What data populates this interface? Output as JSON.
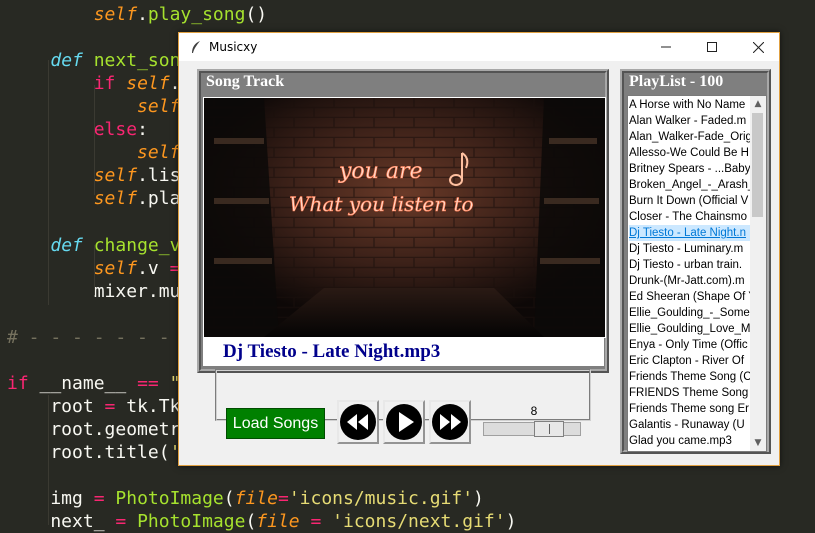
{
  "editor": {
    "lines": [
      {
        "parts": [
          [
            "",
            "        "
          ],
          [
            "self",
            "self"
          ],
          [
            "",
            "."
          ],
          [
            "fn",
            "play_song"
          ],
          [
            "",
            "()"
          ]
        ]
      },
      {
        "parts": []
      },
      {
        "parts": [
          [
            "",
            "    "
          ],
          [
            "kwd",
            "def"
          ],
          [
            "",
            " "
          ],
          [
            "fn",
            "next_son"
          ]
        ]
      },
      {
        "parts": [
          [
            "",
            "        "
          ],
          [
            "kw",
            "if"
          ],
          [
            "",
            " "
          ],
          [
            "self",
            "self"
          ],
          [
            "",
            "."
          ]
        ]
      },
      {
        "parts": [
          [
            "",
            "            "
          ],
          [
            "self",
            "self"
          ]
        ]
      },
      {
        "parts": [
          [
            "",
            "        "
          ],
          [
            "kw",
            "else"
          ],
          [
            "",
            ":"
          ]
        ]
      },
      {
        "parts": [
          [
            "",
            "            "
          ],
          [
            "self",
            "self"
          ]
        ]
      },
      {
        "parts": [
          [
            "",
            "        "
          ],
          [
            "self",
            "self"
          ],
          [
            "",
            ".lis"
          ]
        ]
      },
      {
        "parts": [
          [
            "",
            "        "
          ],
          [
            "self",
            "self"
          ],
          [
            "",
            ".pla"
          ]
        ]
      },
      {
        "parts": []
      },
      {
        "parts": [
          [
            "",
            "    "
          ],
          [
            "kwd",
            "def"
          ],
          [
            "",
            " "
          ],
          [
            "fn",
            "change_v"
          ]
        ]
      },
      {
        "parts": [
          [
            "",
            "        "
          ],
          [
            "self",
            "self"
          ],
          [
            "",
            ".v "
          ],
          [
            "kw",
            "="
          ]
        ]
      },
      {
        "parts": [
          [
            "",
            "        mixer.mu"
          ]
        ]
      },
      {
        "parts": []
      },
      {
        "parts": [
          [
            "comment",
            "# - - - - - - - - - - - - - - - - - - - - - - - - - - - - - - - - - - -"
          ]
        ]
      },
      {
        "parts": []
      },
      {
        "parts": [
          [
            "kw",
            "if"
          ],
          [
            "",
            " __name__ "
          ],
          [
            "kw",
            "=="
          ],
          [
            "",
            " "
          ],
          [
            "str",
            "\""
          ]
        ]
      },
      {
        "parts": [
          [
            "",
            "    root "
          ],
          [
            "kw",
            "="
          ],
          [
            "",
            " tk.Tk"
          ]
        ]
      },
      {
        "parts": [
          [
            "",
            "    root.geometr"
          ]
        ]
      },
      {
        "parts": [
          [
            "",
            "    root.title("
          ],
          [
            "str",
            "'"
          ]
        ]
      },
      {
        "parts": []
      },
      {
        "parts": [
          [
            "",
            "    img "
          ],
          [
            "kw",
            "="
          ],
          [
            "",
            " "
          ],
          [
            "fn",
            "PhotoImage"
          ],
          [
            "",
            "("
          ],
          [
            "param",
            "file"
          ],
          [
            "kw",
            "="
          ],
          [
            "str",
            "'icons/music.gif'"
          ],
          [
            "",
            ")"
          ]
        ]
      },
      {
        "parts": [
          [
            "",
            "    next_ "
          ],
          [
            "kw",
            "="
          ],
          [
            "",
            " "
          ],
          [
            "fn",
            "PhotoImage"
          ],
          [
            "",
            "("
          ],
          [
            "param",
            "file"
          ],
          [
            "",
            " "
          ],
          [
            "kw",
            "="
          ],
          [
            "",
            " "
          ],
          [
            "str",
            "'icons/next.gif'"
          ],
          [
            "",
            ")"
          ]
        ]
      }
    ]
  },
  "window": {
    "title": "Musicxy",
    "minimize_glyph": "—",
    "maximize_glyph": "☐",
    "close_glyph": "✕"
  },
  "song_frame": {
    "label": "Song Track",
    "artwork_text_line1": "you are",
    "artwork_text_line2": "What you listen to",
    "now_playing": "Dj Tiesto - Late Night.mp3"
  },
  "controls": {
    "load_button": "Load Songs",
    "previous_icon": "rewind-icon",
    "play_icon": "play-icon",
    "next_icon": "fast-forward-icon",
    "volume_value": "8",
    "volume_fraction": 0.6
  },
  "playlist": {
    "label": "PlayList - 100",
    "selected_index": 8,
    "items": [
      "A Horse with No Name",
      "Alan Walker - Faded.m",
      "Alan_Walker-Fade_Orig",
      "Allesso-We Could Be H",
      "Britney Spears - ...Baby",
      "Broken_Angel_-_Arash_",
      "Burn It Down (Official V",
      "Closer - The Chainsmo",
      "Dj Tiesto - Late Night.n",
      "Dj Tiesto - Luminary.m",
      "Dj Tiesto - urban train.",
      "Drunk-(Mr-Jatt.com).m",
      "Ed Sheeran (Shape Of Y",
      "Ellie_Goulding_-_Some",
      "Ellie_Goulding_Love_M",
      "Enya - Only Time (Offic",
      "Eric Clapton - River Of",
      "Friends Theme Song (C",
      "FRIENDS Theme Song -",
      "Friends Theme song Er",
      "Galantis - Runaway (U",
      "Glad you came.mp3"
    ],
    "scroll_up_glyph": "▲",
    "scroll_down_glyph": "▼"
  }
}
